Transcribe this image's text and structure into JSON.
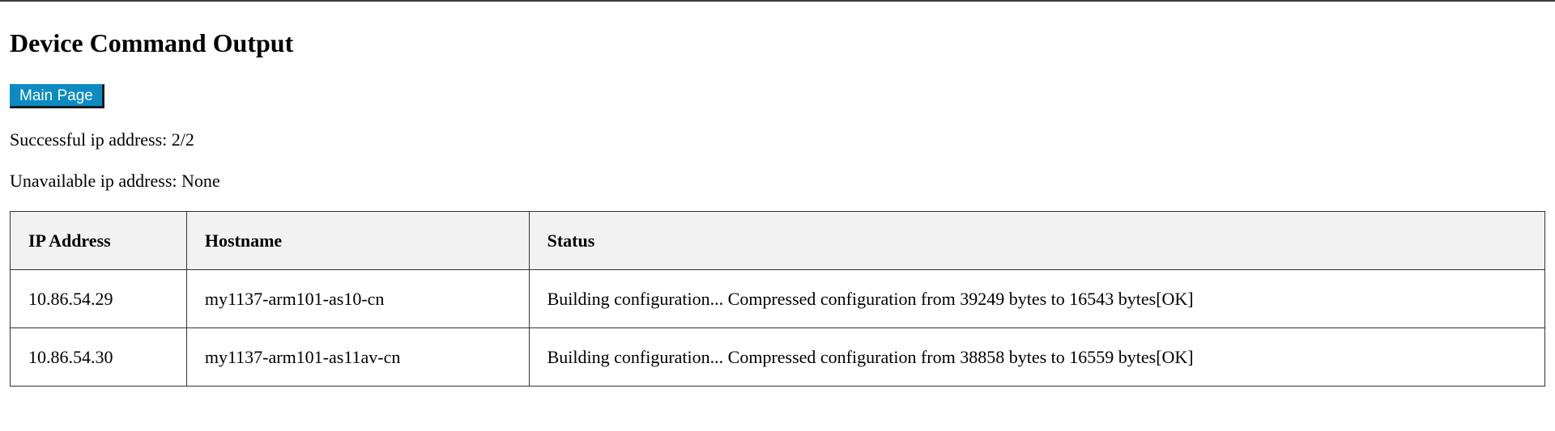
{
  "page": {
    "title": "Device Command Output"
  },
  "nav": {
    "main_page_label": "Main Page"
  },
  "summary": {
    "successful": "Successful ip address: 2/2",
    "unavailable": "Unavailable ip address: None"
  },
  "table": {
    "headers": [
      "IP Address",
      "Hostname",
      "Status"
    ],
    "rows": [
      {
        "ip": "10.86.54.29",
        "hostname": "my1137-arm101-as10-cn",
        "status": "Building configuration... Compressed configuration from 39249 bytes to 16543 bytes[OK]"
      },
      {
        "ip": "10.86.54.30",
        "hostname": "my1137-arm101-as11av-cn",
        "status": "Building configuration... Compressed configuration from 38858 bytes to 16559 bytes[OK]"
      }
    ]
  },
  "colors": {
    "button_bg": "#0b8bc2",
    "header_bg": "#f2f2f2",
    "border": "#333333"
  }
}
